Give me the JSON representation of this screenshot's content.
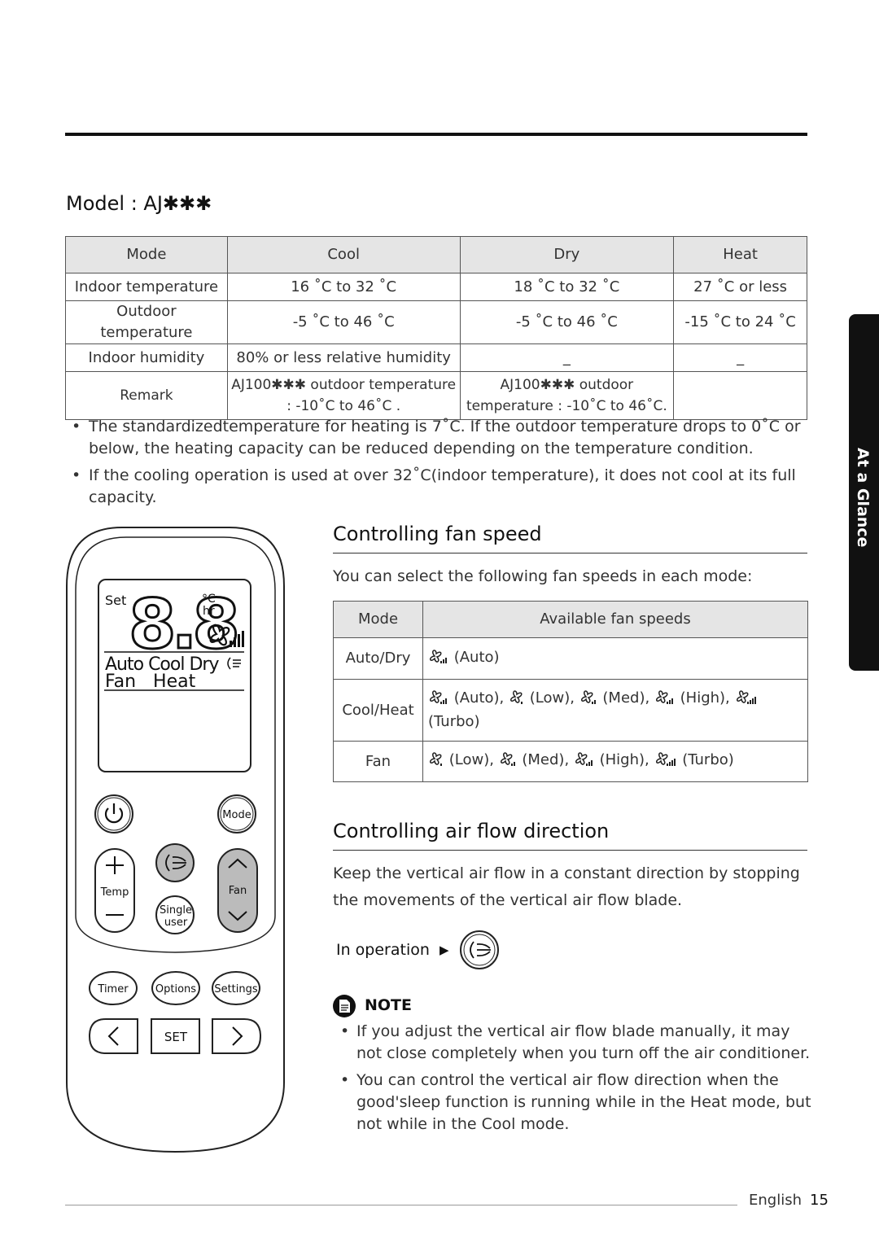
{
  "model_title": "Model : AJ✱✱✱",
  "spec_table": {
    "headers": [
      "Mode",
      "Cool",
      "Dry",
      "Heat"
    ],
    "rows": [
      [
        "Indoor temperature",
        "16 ˚C to 32 ˚C",
        "18 ˚C to 32 ˚C",
        "27 ˚C or less"
      ],
      [
        "Outdoor temperature",
        "-5 ˚C to 46 ˚C",
        "-5 ˚C to 46 ˚C",
        "-15 ˚C to 24 ˚C"
      ],
      [
        "Indoor humidity",
        "80% or less relative humidity",
        "_",
        "_"
      ],
      [
        "Remark",
        "AJ100✱✱✱ outdoor temperature : -10˚C to 46˚C .",
        "AJ100✱✱✱ outdoor temperature : -10˚C to 46˚C.",
        ""
      ]
    ]
  },
  "notes_top": [
    "The standardizedtemperature for heating is 7˚C. If the outdoor temperature drops to 0˚C or below, the heating capacity can be reduced depending on the temperature condition.",
    "If the cooling operation is used at over 32˚C(indoor temperature), it does not cool at its full capacity."
  ],
  "side_tab": "At a Glance",
  "fan_section": {
    "title": "Controlling fan speed",
    "intro": "You can select the following fan speeds in each mode:",
    "headers": [
      "Mode",
      "Available fan speeds"
    ],
    "rows": [
      {
        "mode": "Auto/Dry",
        "speeds": [
          {
            "label": "(Auto)",
            "icon": "fan-auto-icon",
            "level": 3
          }
        ]
      },
      {
        "mode": "Cool/Heat",
        "speeds": [
          {
            "label": "(Auto),",
            "icon": "fan-auto-icon",
            "level": 3
          },
          {
            "label": "(Low),",
            "icon": "fan-low-icon",
            "level": 1
          },
          {
            "label": "(Med),",
            "icon": "fan-med-icon",
            "level": 2
          },
          {
            "label": "(High),",
            "icon": "fan-high-icon",
            "level": 3
          },
          {
            "label": "(Turbo)",
            "icon": "fan-turbo-icon",
            "level": 4
          }
        ]
      },
      {
        "mode": "Fan",
        "speeds": [
          {
            "label": "(Low),",
            "icon": "fan-low-icon",
            "level": 1
          },
          {
            "label": "(Med),",
            "icon": "fan-med-icon",
            "level": 2
          },
          {
            "label": "(High),",
            "icon": "fan-high-icon",
            "level": 3
          },
          {
            "label": "(Turbo)",
            "icon": "fan-turbo-icon",
            "level": 4
          }
        ]
      }
    ]
  },
  "airflow_section": {
    "title": "Controlling air flow direction",
    "para1": "Keep the vertical air flow in a constant direction by stopping",
    "para2": "the movements of the vertical air flow blade.",
    "in_operation": "In operation",
    "note_label": "NOTE",
    "notes": [
      "If you adjust the vertical air flow blade manually, it may not close completely when you turn off the air conditioner.",
      "You can control the vertical air flow direction when the good'sleep function is running while in the Heat mode, but not while in the Cool mode."
    ]
  },
  "remote": {
    "set": "Set",
    "digits": "8.8",
    "unit_c": "°C",
    "unit_hr": "hr",
    "modes_line1": "Auto Cool Dry",
    "modes_line2": "Fan   Heat",
    "mode_btn": "Mode",
    "temp_btn": "Temp",
    "fan_btn": "Fan",
    "single_btn1": "Single",
    "single_btn2": "user",
    "timer_btn": "Timer",
    "options_btn": "Options",
    "settings_btn": "Settings",
    "set_btn": "SET"
  },
  "footer": {
    "language": "English",
    "page": "15"
  }
}
